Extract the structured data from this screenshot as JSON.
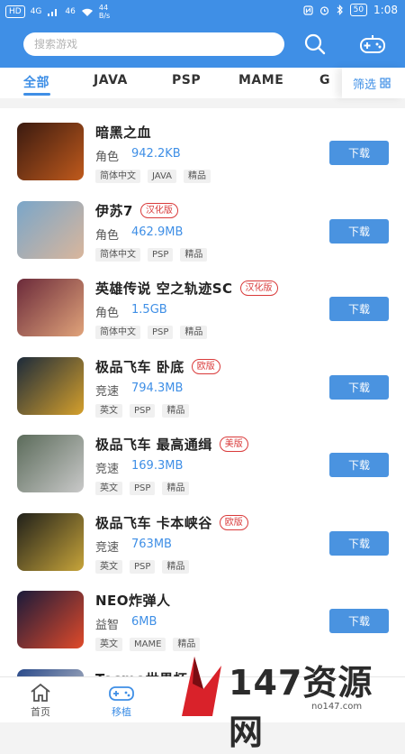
{
  "status_bar": {
    "left_labels": [
      "HD",
      "4G",
      "46",
      "44\nB/s"
    ],
    "battery": "50",
    "time": "1:08"
  },
  "header": {
    "search_placeholder": "搜索游戏",
    "icons": [
      "search-icon",
      "gamepad-icon"
    ]
  },
  "tabs": [
    {
      "label": "全部",
      "active": true
    },
    {
      "label": "JAVA"
    },
    {
      "label": "PSP"
    },
    {
      "label": "MAME"
    },
    {
      "label": "G"
    }
  ],
  "filter_label": "筛选",
  "games": [
    {
      "title": "暗黑之血",
      "badge": "",
      "category": "角色",
      "size": "942.2KB",
      "tags": [
        "简体中文",
        "JAVA",
        "精品"
      ],
      "download": "下载",
      "thumb_colors": [
        "#3a1a10",
        "#c05a1c"
      ]
    },
    {
      "title": "伊苏7",
      "badge": "汉化版",
      "category": "角色",
      "size": "462.9MB",
      "tags": [
        "简体中文",
        "PSP",
        "精品"
      ],
      "download": "下载",
      "thumb_colors": [
        "#7aa6c9",
        "#d9b69c"
      ]
    },
    {
      "title": "英雄传说 空之轨迹SC",
      "badge": "汉化版",
      "category": "角色",
      "size": "1.5GB",
      "tags": [
        "简体中文",
        "PSP",
        "精品"
      ],
      "download": "下载",
      "thumb_colors": [
        "#6b2a3a",
        "#e0a37a"
      ]
    },
    {
      "title": "极品飞车 卧底",
      "badge": "欧版",
      "category": "竞速",
      "size": "794.3MB",
      "tags": [
        "英文",
        "PSP",
        "精品"
      ],
      "download": "下载",
      "thumb_colors": [
        "#1c2a3a",
        "#d5a02c"
      ]
    },
    {
      "title": "极品飞车 最高通缉",
      "badge": "美版",
      "category": "竞速",
      "size": "169.3MB",
      "tags": [
        "英文",
        "PSP",
        "精品"
      ],
      "download": "下载",
      "thumb_colors": [
        "#5b6b5a",
        "#c9c9c9"
      ]
    },
    {
      "title": "极品飞车 卡本峡谷",
      "badge": "欧版",
      "category": "竞速",
      "size": "763MB",
      "tags": [
        "英文",
        "PSP",
        "精品"
      ],
      "download": "下载",
      "thumb_colors": [
        "#20201a",
        "#c7a43a"
      ]
    },
    {
      "title": "NEO炸弹人",
      "badge": "",
      "category": "益智",
      "size": "6MB",
      "tags": [
        "英文",
        "MAME",
        "精品"
      ],
      "download": "下载",
      "thumb_colors": [
        "#1a1a3a",
        "#e04a2a"
      ]
    },
    {
      "title": "Tecmo世界杯",
      "badge": "",
      "category": "",
      "size": "",
      "tags": [],
      "download": "",
      "thumb_colors": [
        "#2a4a8a",
        "#d0d0d0"
      ]
    }
  ],
  "bottom_nav": [
    {
      "label": "首页",
      "active": false
    },
    {
      "label": "移植",
      "active": true
    }
  ],
  "watermark": {
    "main": "147资源网",
    "sub": "no147.com"
  }
}
